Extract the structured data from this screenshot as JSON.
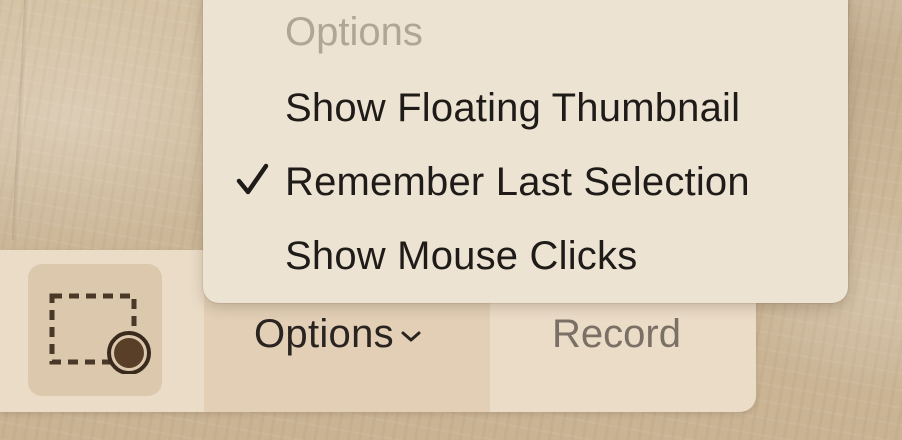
{
  "options_menu": {
    "header": "Options",
    "items": [
      {
        "label": "Show Floating Thumbnail",
        "checked": false
      },
      {
        "label": "Remember Last Selection",
        "checked": true
      },
      {
        "label": "Show Mouse Clicks",
        "checked": false
      }
    ]
  },
  "toolbar": {
    "record_selection_icon": "record-selected-portion-icon",
    "options_label": "Options",
    "options_chevron_icon": "chevron-down-icon",
    "record_label": "Record"
  },
  "colors": {
    "toolbar_bg": "#ebdcc8",
    "selected_tool_bg": "#dcc8ad",
    "menu_bg": "#ece3d3",
    "menu_header_text": "#b0a696",
    "record_text": "#7a7065"
  }
}
